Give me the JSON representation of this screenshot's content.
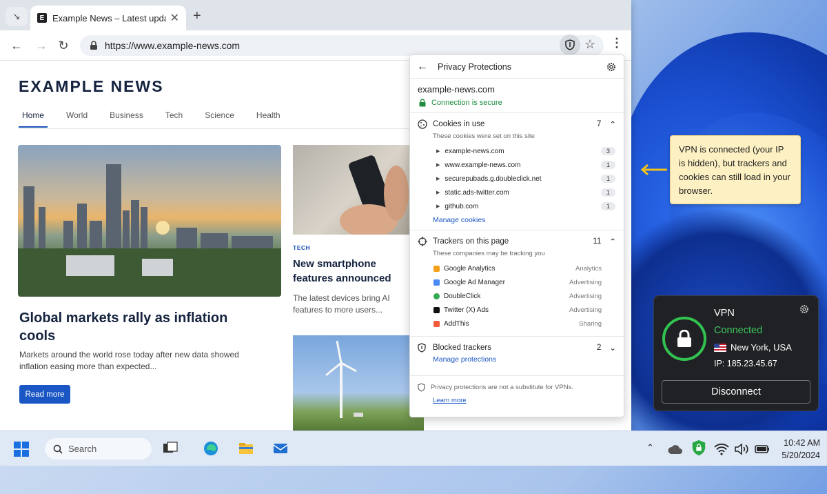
{
  "browser": {
    "tab_title": "Example News – Latest updates",
    "url": "https://www.example-news.com"
  },
  "page": {
    "brand": "EXAMPLE NEWS",
    "nav": [
      "Home",
      "World",
      "Business",
      "Tech",
      "Science",
      "Health"
    ],
    "hero_headline": "Global markets rally as inflation cools",
    "hero_summary": "Markets around the world rose today after new data showed inflation easing more than expected...",
    "read_more": "Read more",
    "card_tag": "TECH",
    "card_headline": "New smartphone features announced",
    "card_summary": "The latest devices bring AI features to more users..."
  },
  "popup": {
    "title": "Privacy Protections",
    "site": "example-news.com",
    "secure": "Connection is secure",
    "cookies": {
      "label": "Cookies in use",
      "count": "7",
      "subtitle": "These cookies were set on this site",
      "items": [
        {
          "name": "example-news.com",
          "count": "3"
        },
        {
          "name": "www.example-news.com",
          "count": "1"
        },
        {
          "name": "securepubads.g.doubleclick.net",
          "count": "1"
        },
        {
          "name": "static.ads-twitter.com",
          "count": "1"
        },
        {
          "name": "github.com",
          "count": "1"
        }
      ],
      "manage": "Manage cookies"
    },
    "trackers": {
      "label": "Trackers on this page",
      "count": "11",
      "subtitle": "These companies may be tracking you",
      "items": [
        {
          "name": "Google Analytics",
          "category": "Analytics",
          "color": "#f4a21b"
        },
        {
          "name": "Google Ad Manager",
          "category": "Advertising",
          "color": "#4a8af4"
        },
        {
          "name": "DoubleClick",
          "category": "Advertising",
          "color": "#34a853"
        },
        {
          "name": "Twitter (X) Ads",
          "category": "Advertising",
          "color": "#111111"
        },
        {
          "name": "AddThis",
          "category": "Sharing",
          "color": "#f25a3c"
        }
      ]
    },
    "blocked": {
      "label": "Blocked trackers",
      "count": "2",
      "manage": "Manage protections"
    },
    "footer": "Privacy protections are not a substitute for VPNs.",
    "learn_more": "Learn more"
  },
  "tooltip": "VPN is connected (your IP is hidden), but trackers and cookies can still load in your browser.",
  "vpn": {
    "title": "VPN",
    "status": "Connected",
    "location": "New York, USA",
    "ip": "IP: 185.23.45.67",
    "disconnect": "Disconnect",
    "status_color": "#3ec45a"
  },
  "taskbar": {
    "search": "Search",
    "time": "10:42 AM",
    "date": "5/20/2024"
  }
}
